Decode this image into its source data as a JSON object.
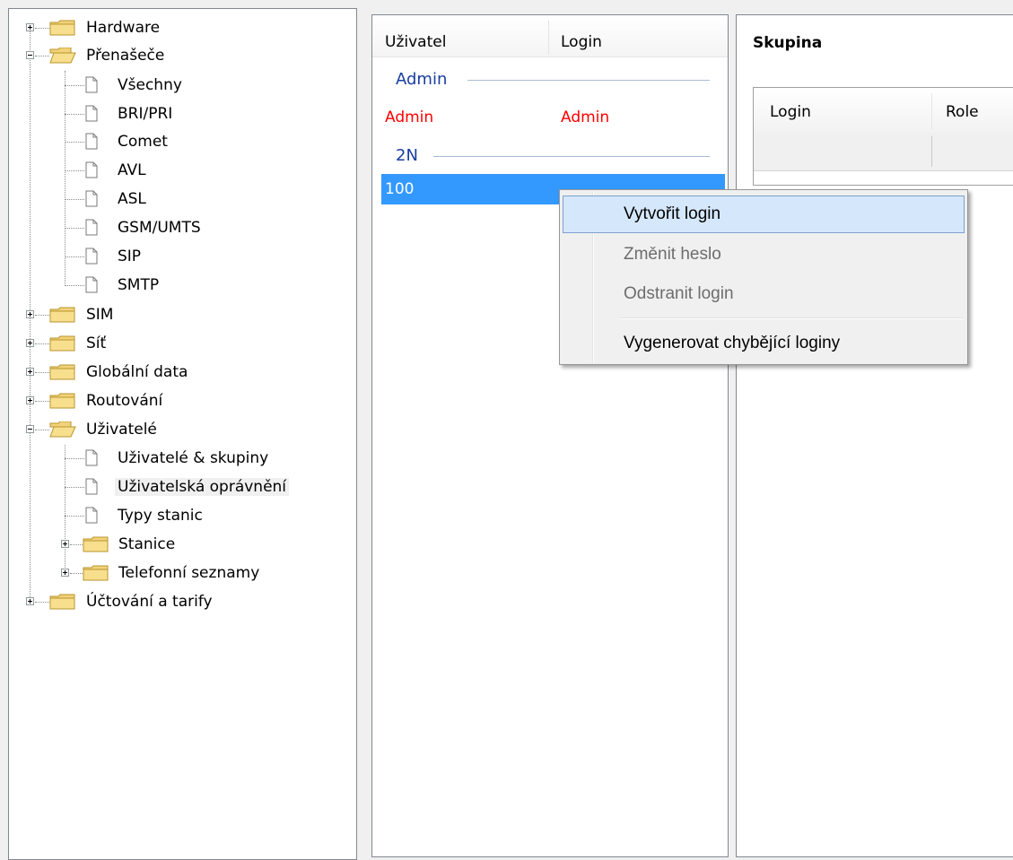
{
  "tree": {
    "items": [
      {
        "label": "Hardware",
        "kind": "folder",
        "expander": "plus",
        "level": 0
      },
      {
        "label": "Přenašeče",
        "kind": "folder-open",
        "expander": "minus",
        "level": 0
      },
      {
        "label": "Všechny",
        "kind": "page",
        "level": 1
      },
      {
        "label": "BRI/PRI",
        "kind": "page",
        "level": 1
      },
      {
        "label": "Comet",
        "kind": "page",
        "level": 1
      },
      {
        "label": "AVL",
        "kind": "page",
        "level": 1
      },
      {
        "label": "ASL",
        "kind": "page",
        "level": 1
      },
      {
        "label": "GSM/UMTS",
        "kind": "page",
        "level": 1
      },
      {
        "label": "SIP",
        "kind": "page",
        "level": 1
      },
      {
        "label": "SMTP",
        "kind": "page",
        "level": 1
      },
      {
        "label": "SIM",
        "kind": "folder",
        "expander": "plus",
        "level": 0
      },
      {
        "label": "Síť",
        "kind": "folder",
        "expander": "plus",
        "level": 0
      },
      {
        "label": "Globální data",
        "kind": "folder",
        "expander": "plus",
        "level": 0
      },
      {
        "label": "Routování",
        "kind": "folder",
        "expander": "plus",
        "level": 0
      },
      {
        "label": "Uživatelé",
        "kind": "folder-open",
        "expander": "minus",
        "level": 0
      },
      {
        "label": "Uživatelé & skupiny",
        "kind": "page",
        "level": 1
      },
      {
        "label": "Uživatelská oprávnění",
        "kind": "page",
        "level": 1,
        "selected": true
      },
      {
        "label": "Typy stanic",
        "kind": "page",
        "level": 1
      },
      {
        "label": "Stanice",
        "kind": "folder",
        "expander": "plus",
        "level": 1
      },
      {
        "label": "Telefonní seznamy",
        "kind": "folder",
        "expander": "plus",
        "level": 1
      },
      {
        "label": "Účtování a tarify",
        "kind": "folder",
        "expander": "plus",
        "level": 0
      }
    ]
  },
  "users": {
    "columns": [
      "Uživatel",
      "Login"
    ],
    "groups": [
      {
        "label": "Admin",
        "rows": [
          {
            "user": "Admin",
            "login": "Admin",
            "color": "#ff0000"
          }
        ]
      },
      {
        "label": "2N",
        "rows": [
          {
            "user": "100",
            "login": "",
            "selected": true
          }
        ]
      }
    ]
  },
  "group_panel": {
    "title": "Skupina",
    "columns": [
      "Login",
      "Role"
    ]
  },
  "context_menu": {
    "items": [
      {
        "label": "Vytvořit login",
        "state": "highlighted"
      },
      {
        "label": "Změnit heslo",
        "state": "disabled"
      },
      {
        "label": "Odstranit login",
        "state": "disabled"
      },
      {
        "label": "Vygenerovat chybějící loginy",
        "state": "normal"
      }
    ]
  },
  "colors": {
    "selection": "#3399ff",
    "menu_highlight": "#d5e7fa",
    "group_header": "#1a3e9f",
    "folder": "#f2d27a"
  }
}
